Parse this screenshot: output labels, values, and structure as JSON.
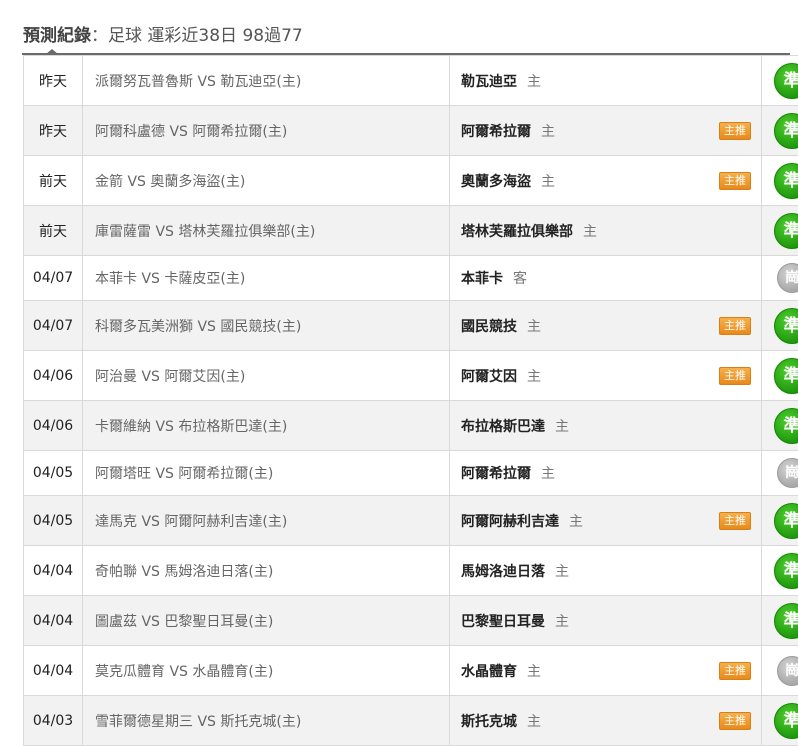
{
  "header": {
    "title_bold": "預測紀錄",
    "title_rest": "：足球 運彩近38日 98過77"
  },
  "labels": {
    "vs": "VS"
  },
  "rows": [
    {
      "date": "昨天",
      "home": "派爾努瓦普魯斯",
      "away": "勒瓦迪亞(主)",
      "pick": "勒瓦迪亞",
      "side": "主",
      "badge": "",
      "result": "準",
      "result_type": "win"
    },
    {
      "date": "昨天",
      "home": "阿爾科盧德",
      "away": "阿爾希拉爾(主)",
      "pick": "阿爾希拉爾",
      "side": "主",
      "badge": "主推",
      "result": "準",
      "result_type": "win"
    },
    {
      "date": "前天",
      "home": "金箭",
      "away": "奧蘭多海盜(主)",
      "pick": "奧蘭多海盜",
      "side": "主",
      "badge": "主推",
      "result": "準",
      "result_type": "win"
    },
    {
      "date": "前天",
      "home": "庫雷薩雷",
      "away": "塔林芙羅拉俱樂部(主)",
      "pick": "塔林芙羅拉俱樂部",
      "side": "主",
      "badge": "",
      "result": "準",
      "result_type": "win"
    },
    {
      "date": "04/07",
      "home": "本菲卡",
      "away": "卡薩皮亞(主)",
      "pick": "本菲卡",
      "side": "客",
      "badge": "",
      "result": "崗",
      "result_type": "push"
    },
    {
      "date": "04/07",
      "home": "科爾多瓦美洲獅",
      "away": "國民競技(主)",
      "pick": "國民競技",
      "side": "主",
      "badge": "主推",
      "result": "準",
      "result_type": "win"
    },
    {
      "date": "04/06",
      "home": "阿治曼",
      "away": "阿爾艾因(主)",
      "pick": "阿爾艾因",
      "side": "主",
      "badge": "主推",
      "result": "準",
      "result_type": "win"
    },
    {
      "date": "04/06",
      "home": "卡爾維納",
      "away": "布拉格斯巴達(主)",
      "pick": "布拉格斯巴達",
      "side": "主",
      "badge": "",
      "result": "準",
      "result_type": "win"
    },
    {
      "date": "04/05",
      "home": "阿爾塔旺",
      "away": "阿爾希拉爾(主)",
      "pick": "阿爾希拉爾",
      "side": "主",
      "badge": "",
      "result": "崗",
      "result_type": "push"
    },
    {
      "date": "04/05",
      "home": "達馬克",
      "away": "阿爾阿赫利吉達(主)",
      "pick": "阿爾阿赫利吉達",
      "side": "主",
      "badge": "主推",
      "result": "準",
      "result_type": "win"
    },
    {
      "date": "04/04",
      "home": "奇帕聯",
      "away": "馬姆洛迪日落(主)",
      "pick": "馬姆洛迪日落",
      "side": "主",
      "badge": "",
      "result": "準",
      "result_type": "win"
    },
    {
      "date": "04/04",
      "home": "圖盧茲",
      "away": "巴黎聖日耳曼(主)",
      "pick": "巴黎聖日耳曼",
      "side": "主",
      "badge": "",
      "result": "準",
      "result_type": "win"
    },
    {
      "date": "04/04",
      "home": "莫克瓜體育",
      "away": "水晶體育(主)",
      "pick": "水晶體育",
      "side": "主",
      "badge": "主推",
      "result": "崗",
      "result_type": "push"
    },
    {
      "date": "04/03",
      "home": "雪菲爾德星期三",
      "away": "斯托克城(主)",
      "pick": "斯托克城",
      "side": "主",
      "badge": "主推",
      "result": "準",
      "result_type": "win"
    }
  ]
}
